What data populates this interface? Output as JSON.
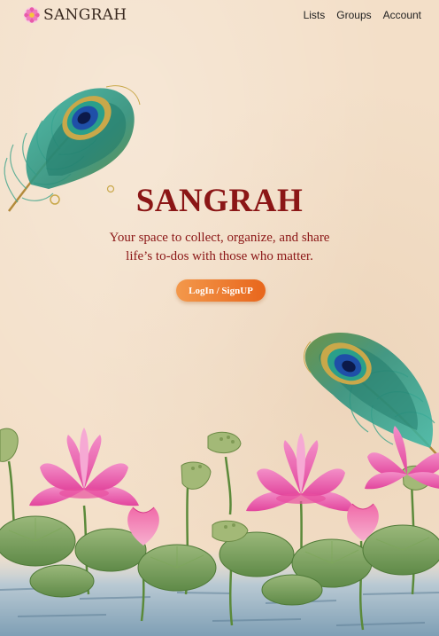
{
  "navbar": {
    "brand_name": "SANGRAH",
    "brand_icon": "lotus-flower-icon",
    "links": [
      {
        "label": "Lists"
      },
      {
        "label": "Groups"
      },
      {
        "label": "Account"
      }
    ]
  },
  "hero": {
    "title": "SANGRAH",
    "tagline": "Your space to collect, organize, and share life’s to-dos with those who matter.",
    "cta_label": "LogIn / SignUP"
  },
  "decor": {
    "feather_icon": "peacock-feather-icon",
    "scene": "lotus-pond-illustration"
  },
  "colors": {
    "background": "#f3dfc8",
    "title": "#8b1616",
    "cta_start": "#f3984b",
    "cta_end": "#e8661c",
    "lotus_pink": "#f06ab8",
    "leaf_green": "#6f9a4f"
  }
}
